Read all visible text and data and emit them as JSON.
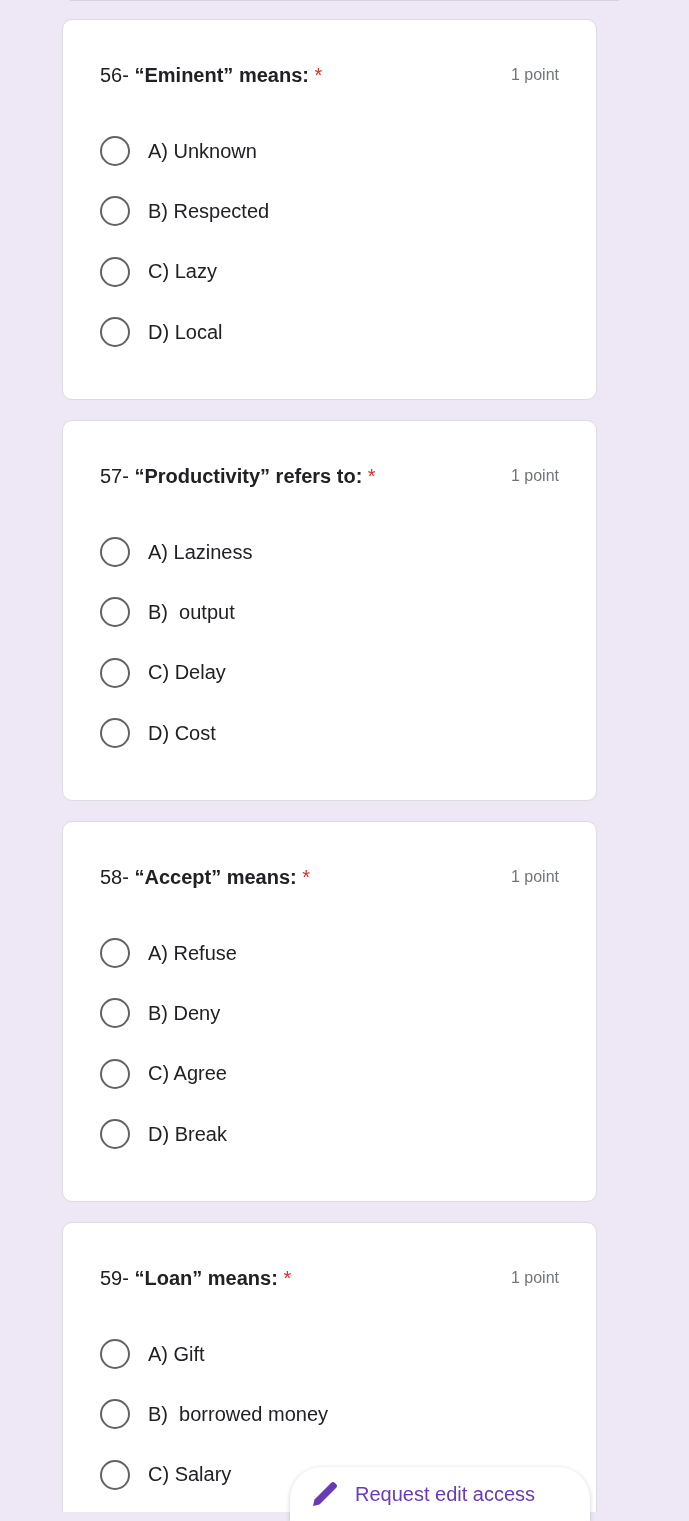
{
  "questions": [
    {
      "text": "56- **“Eminent” means:**",
      "required_mark": "*",
      "points": "1 point",
      "options": [
        {
          "label": "A) Unknown",
          "selected": false
        },
        {
          "label": "B) Respected",
          "selected": false
        },
        {
          "label": "C) Lazy",
          "selected": false
        },
        {
          "label": "D) Local",
          "selected": false
        }
      ]
    },
    {
      "text": "57- **“Productivity” refers to:**",
      "required_mark": "*",
      "points": "1 point",
      "options": [
        {
          "label": "A) Laziness",
          "selected": false
        },
        {
          "label": "B)  output",
          "selected": false
        },
        {
          "label": "C) Delay",
          "selected": false
        },
        {
          "label": "D) Cost",
          "selected": false
        }
      ]
    },
    {
      "text": "58- **“Accept” means:**",
      "required_mark": "*",
      "points": "1 point",
      "options": [
        {
          "label": "A) Refuse",
          "selected": false
        },
        {
          "label": "B) Deny",
          "selected": false
        },
        {
          "label": "C) Agree",
          "selected": false
        },
        {
          "label": "D) Break",
          "selected": false
        }
      ]
    },
    {
      "text": "59- **“Loan” means:**",
      "required_mark": "*",
      "points": "1 point",
      "options": [
        {
          "label": "A) Gift",
          "selected": false
        },
        {
          "label": "B)  borrowed money",
          "selected": false
        },
        {
          "label": "C) Salary",
          "selected": false
        }
      ]
    }
  ],
  "request_edit_button": {
    "label": "Request edit access"
  }
}
